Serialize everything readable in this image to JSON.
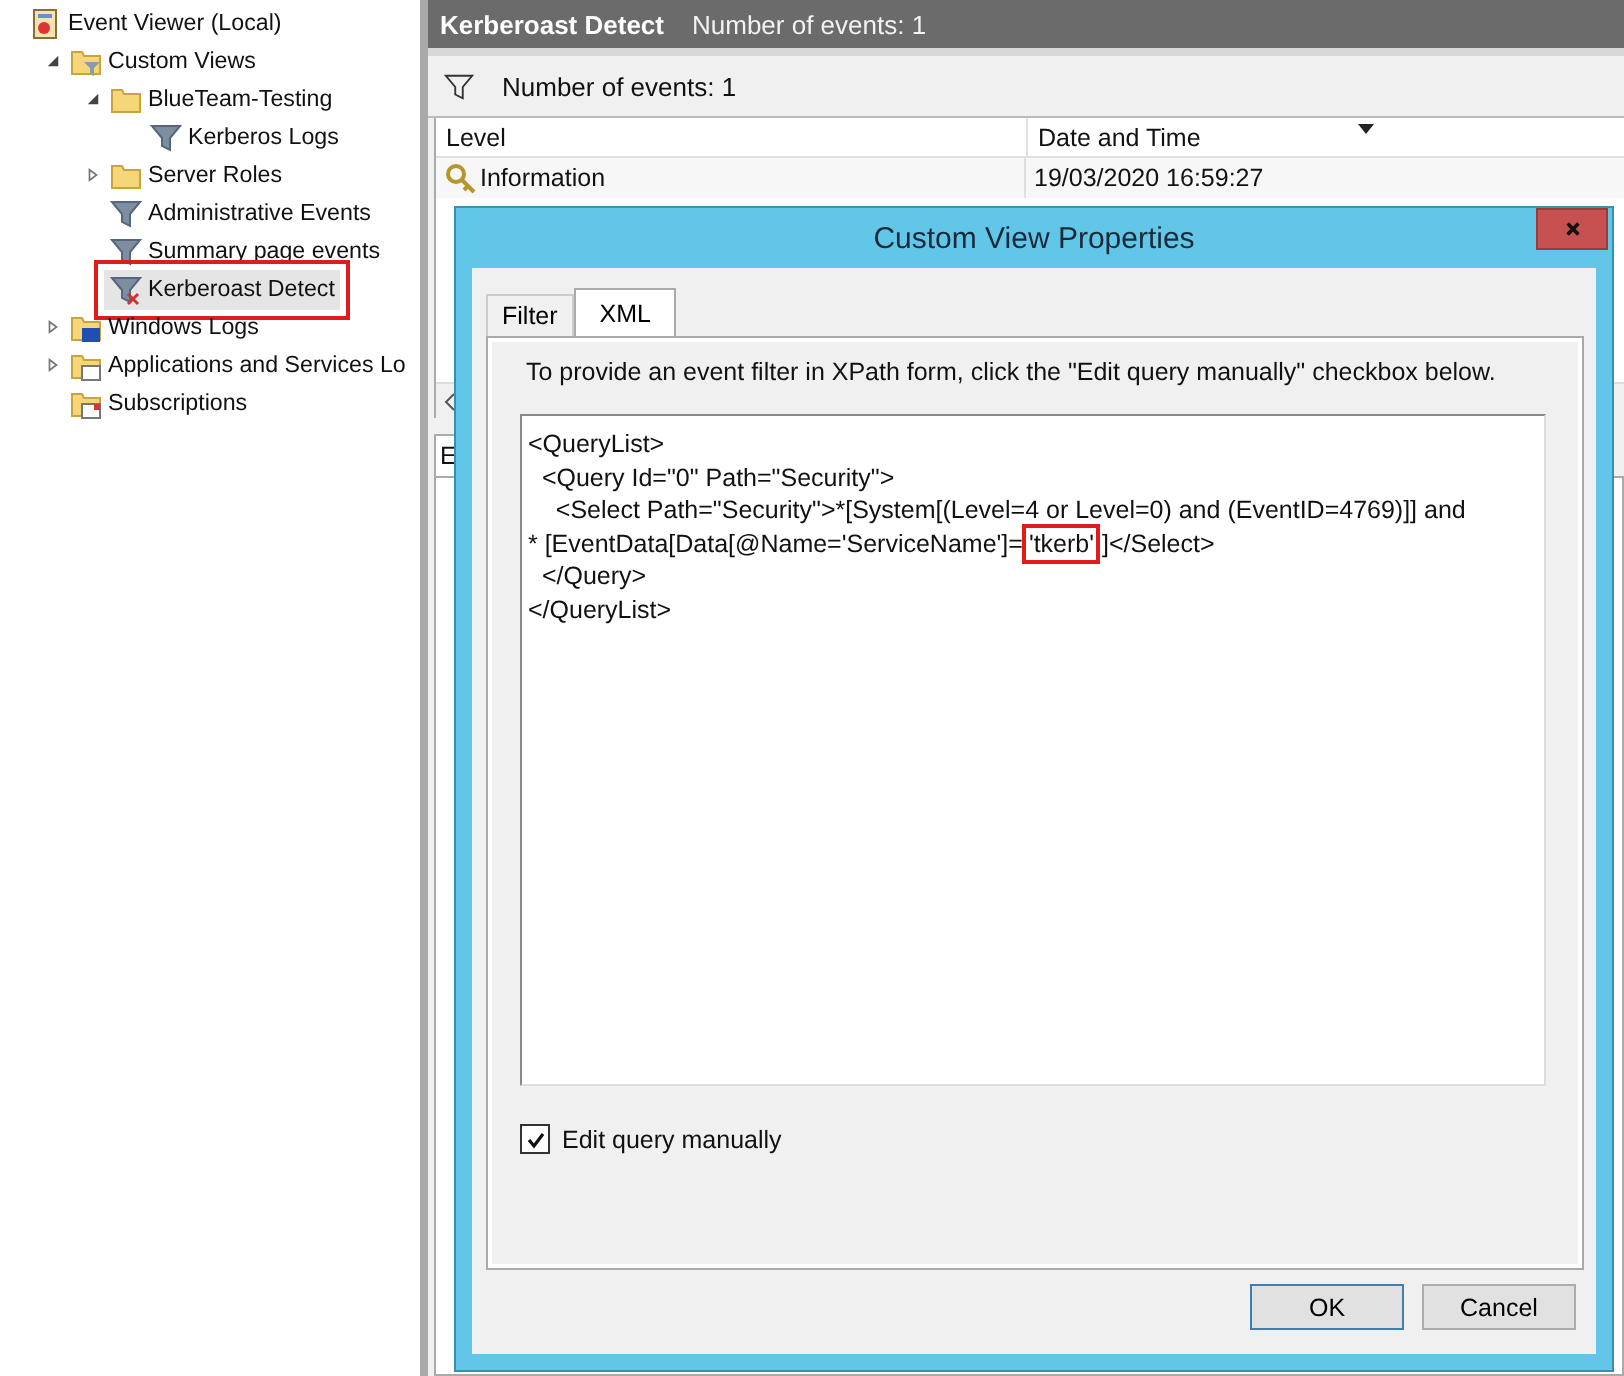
{
  "tree": [
    {
      "label": "Event Viewer (Local)",
      "kind": "root",
      "selected": false,
      "highlighted": false,
      "children": [
        {
          "label": "Custom Views",
          "kind": "views-folder",
          "expanded": true,
          "selected": false,
          "highlighted": false,
          "children": [
            {
              "label": "BlueTeam-Testing",
              "kind": "folder",
              "expanded": true,
              "selected": false,
              "highlighted": false,
              "children": [
                {
                  "label": "Kerberos Logs",
                  "kind": "filter",
                  "selected": false,
                  "highlighted": false
                }
              ]
            },
            {
              "label": "Server Roles",
              "kind": "folder",
              "expanded": false,
              "selected": false,
              "highlighted": false
            },
            {
              "label": "Administrative Events",
              "kind": "filter",
              "selected": false,
              "highlighted": false
            },
            {
              "label": "Summary page events",
              "kind": "filter",
              "selected": false,
              "highlighted": false
            },
            {
              "label": "Kerberoast Detect",
              "kind": "custom-filter",
              "selected": true,
              "highlighted": true
            }
          ]
        },
        {
          "label": "Windows Logs",
          "kind": "logs-folder",
          "expanded": false,
          "selected": false,
          "highlighted": false
        },
        {
          "label": "Applications and Services Lo",
          "kind": "apps-folder",
          "expanded": false,
          "selected": false,
          "highlighted": false
        },
        {
          "label": "Subscriptions",
          "kind": "subscriptions",
          "selected": false,
          "highlighted": false
        }
      ]
    }
  ],
  "header": {
    "title": "Kerberoast Detect",
    "subtitle": "Number of events: 1"
  },
  "toolbar": {
    "text": "Number of events: 1"
  },
  "table": {
    "columns": [
      {
        "label": "Level",
        "sorted": false
      },
      {
        "label": "Date and Time",
        "sorted": true
      }
    ],
    "rows": [
      {
        "level": "Information",
        "date_time": "19/03/2020 16:59:27"
      }
    ]
  },
  "lower_pane": {
    "tab_label": "E"
  },
  "dialog": {
    "title": "Custom View Properties",
    "tabs": [
      {
        "label": "Filter",
        "selected": false
      },
      {
        "label": "XML",
        "selected": true
      }
    ],
    "instruction": "To provide an event filter in XPath form, click the \"Edit query manually\" checkbox below.",
    "xml_lines": [
      {
        "text": "<QueryList>"
      },
      {
        "text": "  <Query Id=\"0\" Path=\"Security\">"
      },
      {
        "text": "    <Select Path=\"Security\">*[System[(Level=4 or Level=0) and (EventID=4769)]] and"
      },
      {
        "text": "* [EventData[Data[@Name='ServiceName']=",
        "boxed": "'tkerb'",
        "after": "]</Select>"
      },
      {
        "text": "  </Query>"
      },
      {
        "text": "</QueryList>"
      }
    ],
    "checkbox": {
      "label": "Edit query manually",
      "checked": true
    },
    "buttons": [
      {
        "label": "OK",
        "default": true
      },
      {
        "label": "Cancel",
        "default": false
      }
    ]
  }
}
